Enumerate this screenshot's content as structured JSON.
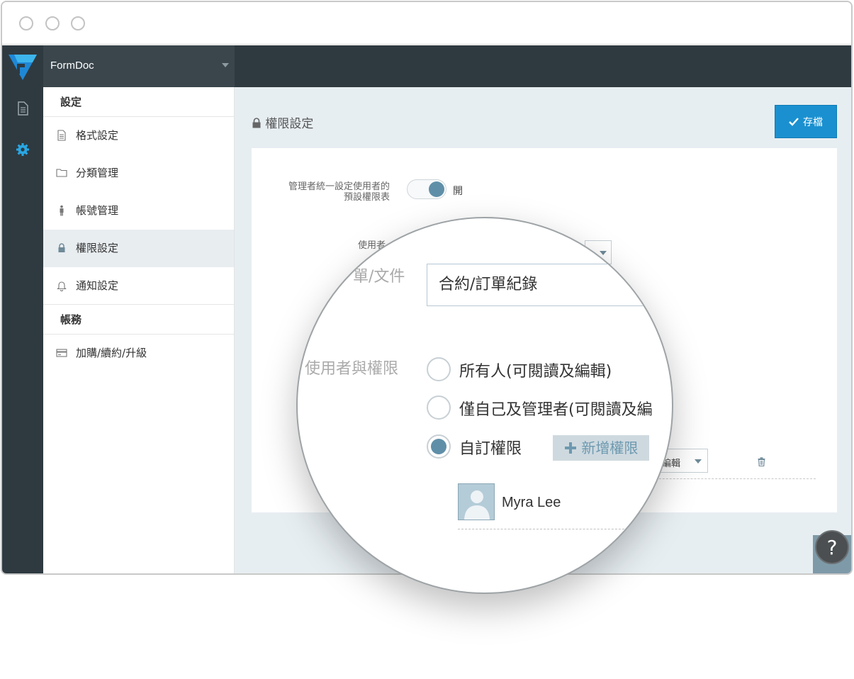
{
  "app": {
    "name": "FormDoc"
  },
  "sidebar": {
    "section_settings": "設定",
    "items": [
      {
        "label": "格式設定"
      },
      {
        "label": "分類管理"
      },
      {
        "label": "帳號管理"
      },
      {
        "label": "權限設定"
      },
      {
        "label": "通知設定"
      }
    ],
    "section_account": "帳務",
    "account_items": [
      {
        "label": "加購/續約/升級"
      }
    ]
  },
  "main": {
    "title": "權限設定",
    "save_label": "存檔",
    "admin_setting_label_line1": "管理者統一設定使用者的",
    "admin_setting_label_line2": "預設權限表",
    "toggle_state": "開",
    "user_label_partial": "使用者",
    "edit_partial": "編輯"
  },
  "magnifier": {
    "form_label_partial": "單/文件",
    "form_value": "合約/訂單紀錄",
    "users_perm_label": "使用者與權限",
    "options": [
      {
        "label": "所有人(可閱讀及編輯)",
        "selected": false
      },
      {
        "label": "僅自己及管理者(可閱讀及編",
        "selected": false
      },
      {
        "label": "自訂權限",
        "selected": true
      }
    ],
    "add_perm_label": "新增權限",
    "user_name": "Myra Lee"
  },
  "help": {
    "label": "?"
  },
  "colors": {
    "topbar": "#2f3a40",
    "accent": "#1a90d0",
    "radio_fill": "#5f8fa8",
    "main_bg": "#e7eef2"
  }
}
